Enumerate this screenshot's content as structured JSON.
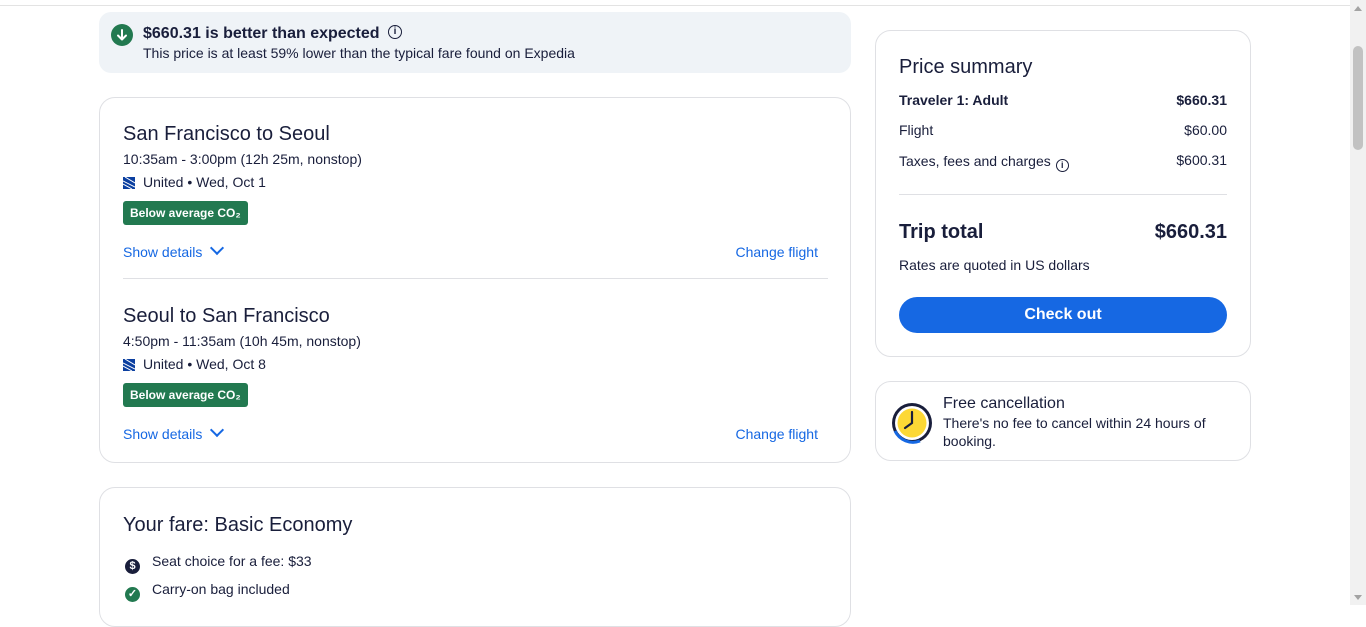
{
  "banner": {
    "title": "$660.31 is better than expected",
    "info_glyph": "i",
    "subtitle": "This price is at least 59% lower than the typical fare found on Expedia"
  },
  "flights": [
    {
      "route": "San Francisco to Seoul",
      "times": "10:35am - 3:00pm (12h 25m, nonstop)",
      "airline": "United • Wed, Oct 1",
      "co2_badge": "Below average CO₂",
      "show_details": "Show details",
      "change_flight": "Change flight"
    },
    {
      "route": "Seoul to San Francisco",
      "times": "4:50pm - 11:35am (10h 45m, nonstop)",
      "airline": "United • Wed, Oct 8",
      "co2_badge": "Below average CO₂",
      "show_details": "Show details",
      "change_flight": "Change flight"
    }
  ],
  "fare": {
    "title": "Your fare: Basic Economy",
    "items": [
      {
        "text": "Seat choice for a fee: $33",
        "icon": "dollar-icon",
        "glyph": "$"
      },
      {
        "text": "Carry-on bag included",
        "icon": "check-icon",
        "glyph": "✓"
      }
    ]
  },
  "summary": {
    "title": "Price summary",
    "traveler_label": "Traveler 1: Adult",
    "traveler_value": "$660.31",
    "flight_label": "Flight",
    "flight_value": "$60.00",
    "taxes_label": "Taxes, fees and charges",
    "taxes_info_glyph": "i",
    "taxes_value": "$600.31",
    "total_label": "Trip total",
    "total_value": "$660.31",
    "rates_note": "Rates are quoted in US dollars",
    "checkout_label": "Check out"
  },
  "cancellation": {
    "title": "Free cancellation",
    "description": "There's no fee to cancel within 24 hours of booking."
  },
  "colors": {
    "accent_blue": "#1668e3",
    "green": "#227950",
    "text": "#191e3b",
    "banner_bg": "#eff3f7"
  }
}
